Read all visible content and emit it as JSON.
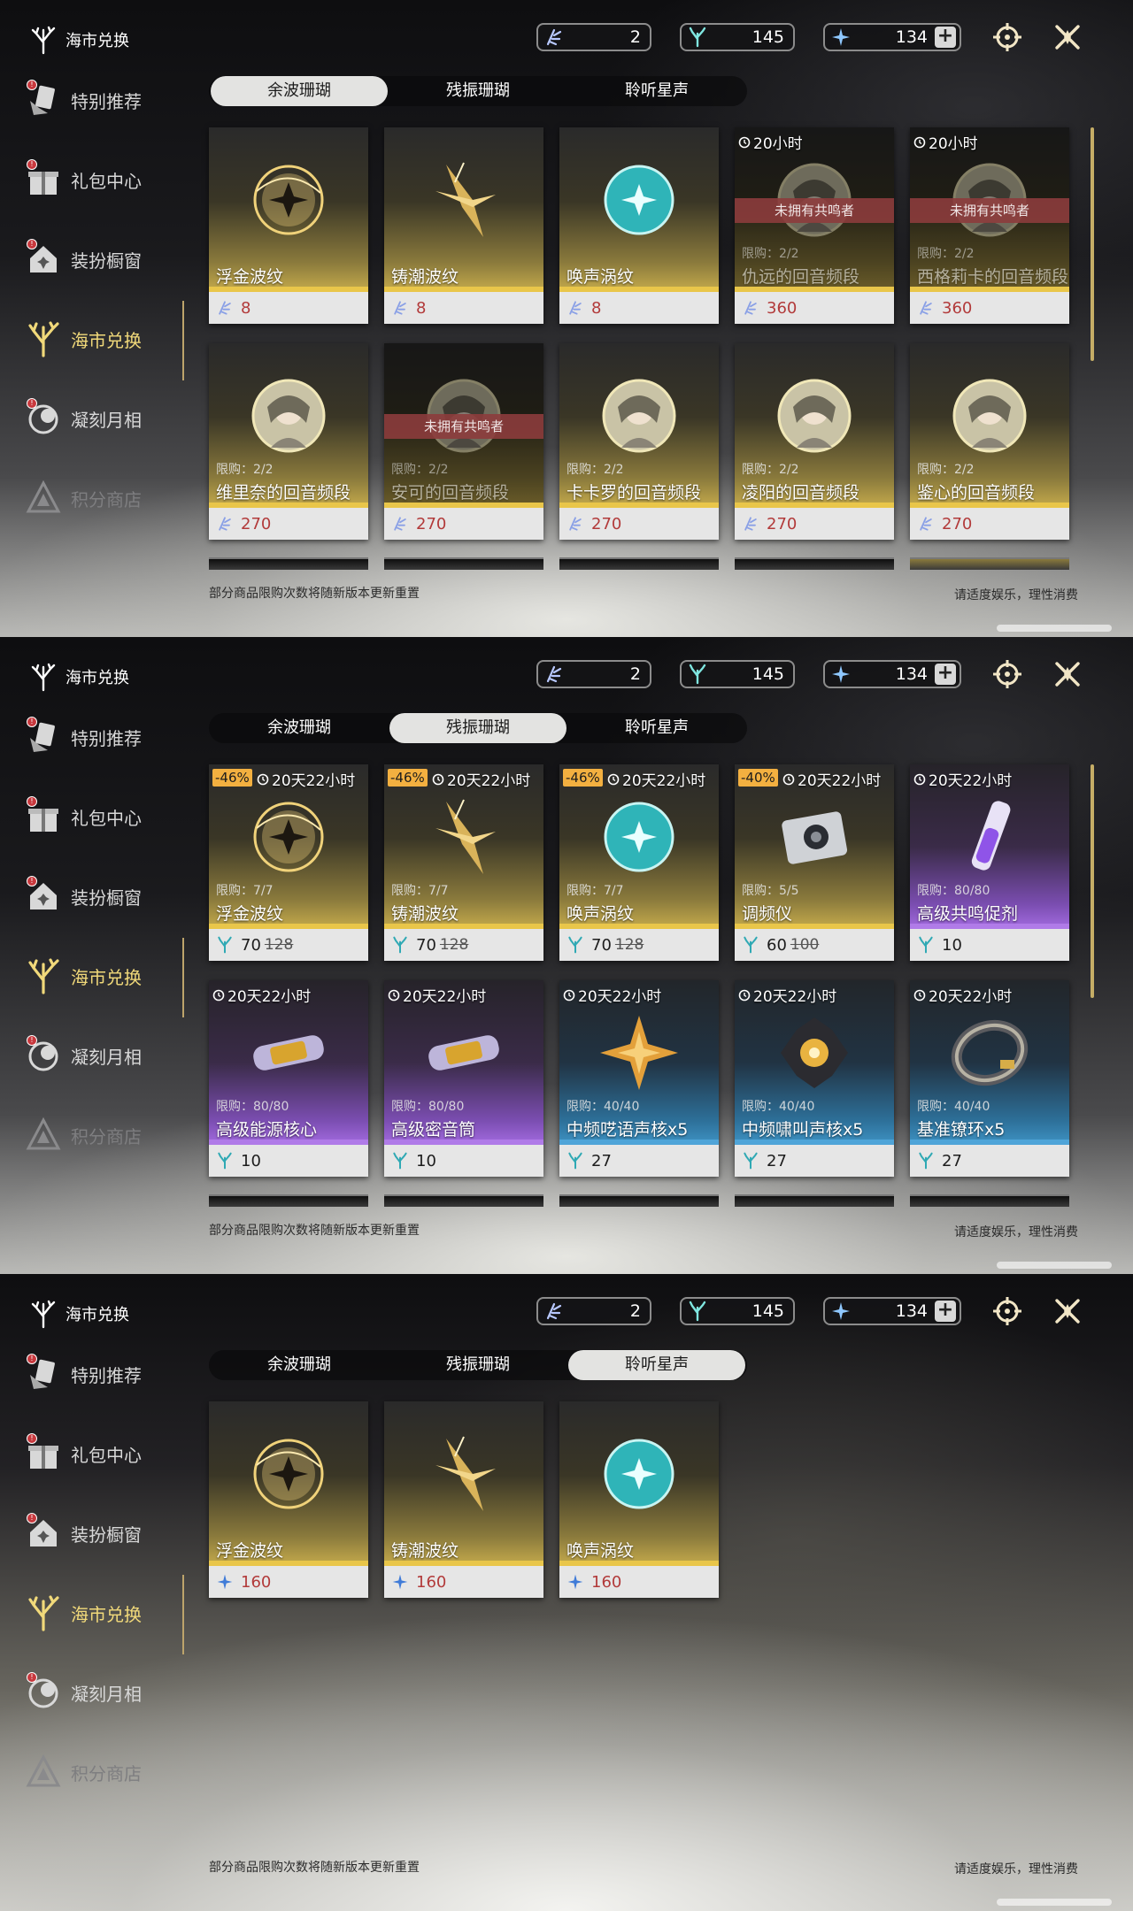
{
  "colors": {
    "accent_gold": "#f1d97a",
    "price_red": "#b23a3a",
    "discount": "#f3b040",
    "rarity_gold": "#e9c64a",
    "rarity_purple": "#b07be8",
    "rarity_blue": "#4fa4d8"
  },
  "header": {
    "title": "海市兑换",
    "currency": [
      {
        "icon": "shell-credit-icon",
        "amount": "2"
      },
      {
        "icon": "coral-icon",
        "amount": "145"
      },
      {
        "icon": "star-coral-icon",
        "amount": "134"
      }
    ]
  },
  "sidebar": {
    "items": [
      {
        "label": "特别推荐",
        "icon": "hand-card-icon",
        "badge": true
      },
      {
        "label": "礼包中心",
        "icon": "gift-icon",
        "badge": true
      },
      {
        "label": "装扮橱窗",
        "icon": "house-icon",
        "badge": true
      },
      {
        "label": "海市兑换",
        "icon": "coral-tree-icon",
        "badge": false
      },
      {
        "label": "凝刻月相",
        "icon": "moon-sphere-icon",
        "badge": true
      },
      {
        "label": "积分商店",
        "icon": "triangle-icon",
        "badge": false
      }
    ]
  },
  "tabs": [
    "余波珊瑚",
    "残振珊瑚",
    "聆听星声"
  ],
  "footer": {
    "left": "部分商品限购次数将随新版本更新重置",
    "right": "请适度娱乐，理性消费"
  },
  "panels": [
    {
      "selected_tab": 0,
      "cards": [
        {
          "name": "浮金波纹",
          "price": "8",
          "rarity": "gold",
          "art": "gold-orb-icon",
          "cur": "shell-credit-icon"
        },
        {
          "name": "铸潮波纹",
          "price": "8",
          "rarity": "gold",
          "art": "gold-sword-icon",
          "cur": "shell-credit-icon"
        },
        {
          "name": "唤声涡纹",
          "price": "8",
          "rarity": "gold",
          "art": "teal-orb-icon",
          "cur": "shell-credit-icon"
        },
        {
          "name": "仇远的回音频段",
          "price": "360",
          "rarity": "gold",
          "art": "portrait-icon",
          "cur": "shell-credit-icon",
          "timer": "20小时",
          "limit": "限购：2/2",
          "locked": true,
          "banner": "未拥有共鸣者"
        },
        {
          "name": "西格莉卡的回音频段",
          "price": "360",
          "rarity": "gold",
          "art": "portrait-icon",
          "cur": "shell-credit-icon",
          "timer": "20小时",
          "limit": "限购：2/2",
          "locked": true,
          "banner": "未拥有共鸣者"
        },
        {
          "name": "维里奈的回音频段",
          "price": "270",
          "rarity": "gold",
          "art": "portrait-icon",
          "cur": "shell-credit-icon",
          "limit": "限购：2/2"
        },
        {
          "name": "安可的回音频段",
          "price": "270",
          "rarity": "gold",
          "art": "portrait-icon",
          "cur": "shell-credit-icon",
          "limit": "限购：2/2",
          "locked": true,
          "banner": "未拥有共鸣者"
        },
        {
          "name": "卡卡罗的回音频段",
          "price": "270",
          "rarity": "gold",
          "art": "portrait-icon",
          "cur": "shell-credit-icon",
          "limit": "限购：2/2"
        },
        {
          "name": "凌阳的回音频段",
          "price": "270",
          "rarity": "gold",
          "art": "portrait-icon",
          "cur": "shell-credit-icon",
          "limit": "限购：2/2"
        },
        {
          "name": "鉴心的回音频段",
          "price": "270",
          "rarity": "gold",
          "art": "portrait-icon",
          "cur": "shell-credit-icon",
          "limit": "限购：2/2"
        }
      ]
    },
    {
      "selected_tab": 1,
      "cards": [
        {
          "name": "浮金波纹",
          "price": "70",
          "old_price": "128",
          "discount": "-46%",
          "timer": "20天22小时",
          "limit": "限购：7/7",
          "rarity": "gold",
          "art": "gold-orb-icon",
          "cur": "coral-icon"
        },
        {
          "name": "铸潮波纹",
          "price": "70",
          "old_price": "128",
          "discount": "-46%",
          "timer": "20天22小时",
          "limit": "限购：7/7",
          "rarity": "gold",
          "art": "gold-sword-icon",
          "cur": "coral-icon"
        },
        {
          "name": "唤声涡纹",
          "price": "70",
          "old_price": "128",
          "discount": "-46%",
          "timer": "20天22小时",
          "limit": "限购：7/7",
          "rarity": "gold",
          "art": "teal-orb-icon",
          "cur": "coral-icon"
        },
        {
          "name": "调频仪",
          "price": "60",
          "old_price": "100",
          "discount": "-40%",
          "timer": "20天22小时",
          "limit": "限购：5/5",
          "rarity": "gold",
          "art": "device-icon",
          "cur": "coral-icon"
        },
        {
          "name": "高级共鸣促剂",
          "price": "10",
          "timer": "20天22小时",
          "limit": "限购：80/80",
          "rarity": "purple",
          "art": "vial-icon",
          "cur": "coral-icon"
        },
        {
          "name": "高级能源核心",
          "price": "10",
          "timer": "20天22小时",
          "limit": "限购：80/80",
          "rarity": "purple",
          "art": "capsule-icon",
          "cur": "coral-icon"
        },
        {
          "name": "高级密音筒",
          "price": "10",
          "timer": "20天22小时",
          "limit": "限购：80/80",
          "rarity": "purple",
          "art": "capsule-icon",
          "cur": "coral-icon"
        },
        {
          "name": "中频呓语声核x5",
          "price": "27",
          "timer": "20天22小时",
          "limit": "限购：40/40",
          "rarity": "blue",
          "art": "star-shard-icon",
          "cur": "coral-icon"
        },
        {
          "name": "中频啸叫声核x5",
          "price": "27",
          "timer": "20天22小时",
          "limit": "限购：40/40",
          "rarity": "blue",
          "art": "dark-core-icon",
          "cur": "coral-icon"
        },
        {
          "name": "基准镣环x5",
          "price": "27",
          "timer": "20天22小时",
          "limit": "限购：40/40",
          "rarity": "blue",
          "art": "ring-icon",
          "cur": "coral-icon"
        }
      ]
    },
    {
      "selected_tab": 2,
      "cards": [
        {
          "name": "浮金波纹",
          "price": "160",
          "rarity": "gold",
          "art": "gold-orb-icon",
          "cur": "star-coral-icon"
        },
        {
          "name": "铸潮波纹",
          "price": "160",
          "rarity": "gold",
          "art": "gold-sword-icon",
          "cur": "star-coral-icon"
        },
        {
          "name": "唤声涡纹",
          "price": "160",
          "rarity": "gold",
          "art": "teal-orb-icon",
          "cur": "star-coral-icon"
        }
      ]
    }
  ]
}
